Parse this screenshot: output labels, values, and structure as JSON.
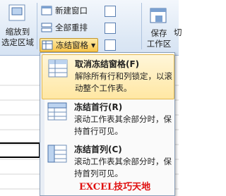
{
  "ribbon": {
    "zoom_to_selection": "缩放到\n选定区域",
    "new_window": "新建窗口",
    "arrange_all": "全部重排",
    "freeze_panes": "冻结窗格",
    "save_workspace": "保存\n工作区",
    "switch_partial": "切"
  },
  "menu": {
    "items": [
      {
        "title": "取消冻结窗格(F)",
        "desc": "解除所有行和列锁定，以滚动整个工作表。"
      },
      {
        "title": "冻结首行(R)",
        "desc": "滚动工作表其余部分时，保持首行可见。"
      },
      {
        "title": "冻结首列(C)",
        "desc": "滚动工作表其余部分时，保持首列可见。"
      }
    ]
  },
  "watermark": "EXCEL技巧天地"
}
